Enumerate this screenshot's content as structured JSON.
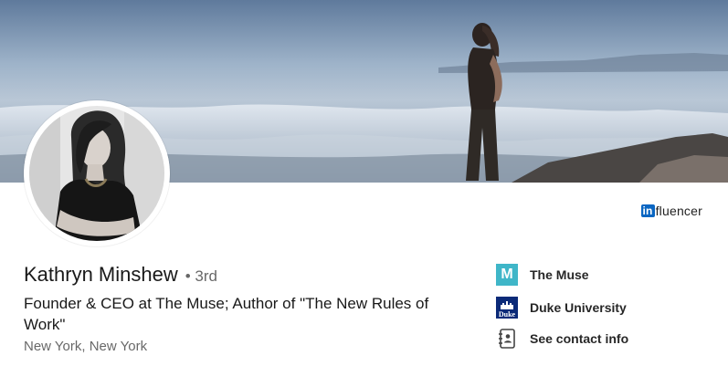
{
  "profile": {
    "name": "Kathryn Minshew",
    "degree": "• 3rd",
    "headline": "Founder & CEO at The Muse; Author of \"The New Rules of Work\"",
    "location": "New York, New York"
  },
  "badge": {
    "in_text": "in",
    "rest_text": "fluencer"
  },
  "sidebar": {
    "items": [
      {
        "label": "The Muse",
        "logo_text": "M",
        "color": "#3fb6c8"
      },
      {
        "label": "Duke University",
        "logo_text": "Duke",
        "color": "#0b2a78"
      },
      {
        "label": "See contact info",
        "icon": "contact-book-icon"
      }
    ]
  },
  "colors": {
    "brand_blue": "#0a66c2",
    "text_primary": "#1f1f1f",
    "text_secondary": "#666666"
  }
}
